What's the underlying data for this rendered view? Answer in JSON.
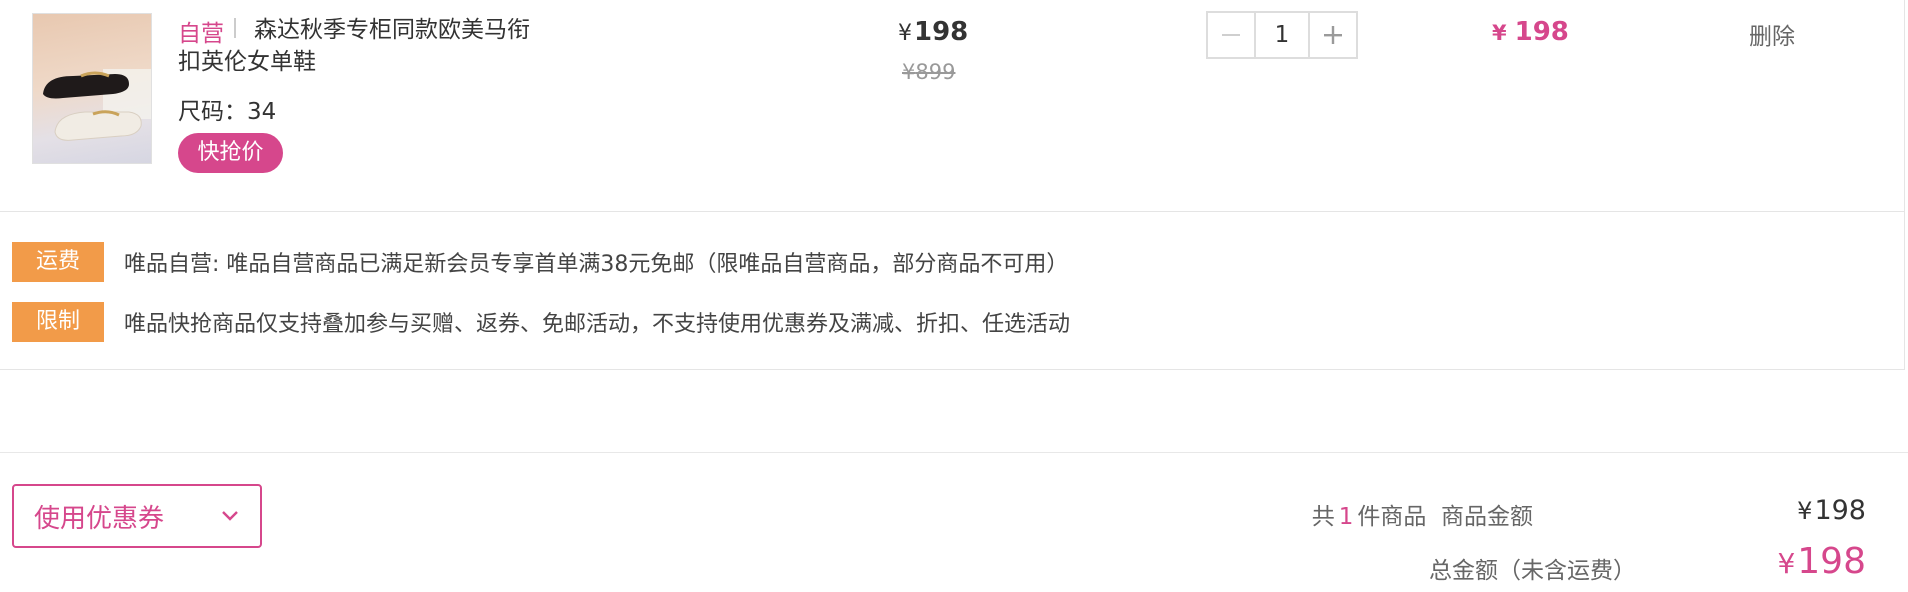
{
  "item": {
    "self_tag": "自营",
    "title": "森达秋季专柜同款欧美马衔扣英伦女单鞋",
    "size_label": "尺码：",
    "size_value": "34",
    "badge": "快抢价",
    "currency": "¥",
    "price": "198",
    "original_price": "899",
    "quantity": "1",
    "subtotal": "198",
    "delete_label": "删除",
    "image_icon": "loafer-shoes-image"
  },
  "notices": [
    {
      "tag": "运费",
      "text": "唯品自营: 唯品自营商品已满足新会员专享首单满38元免邮（限唯品自营商品，部分商品不可用）"
    },
    {
      "tag": "限制",
      "text": "唯品快抢商品仅支持叠加参与买赠、返券、免邮活动，不支持使用优惠券及满减、折扣、任选活动"
    }
  ],
  "coupon": {
    "label": "使用优惠券",
    "icon": "chevron-down-icon"
  },
  "summary": {
    "count_prefix": "共",
    "count": "1",
    "count_suffix": "件商品",
    "amount_label": "商品金额",
    "amount": "198",
    "total_label": "总金额（未含运费）",
    "total": "198"
  },
  "colors": {
    "accent": "#d6478c",
    "notice_tag": "#f29b49"
  }
}
